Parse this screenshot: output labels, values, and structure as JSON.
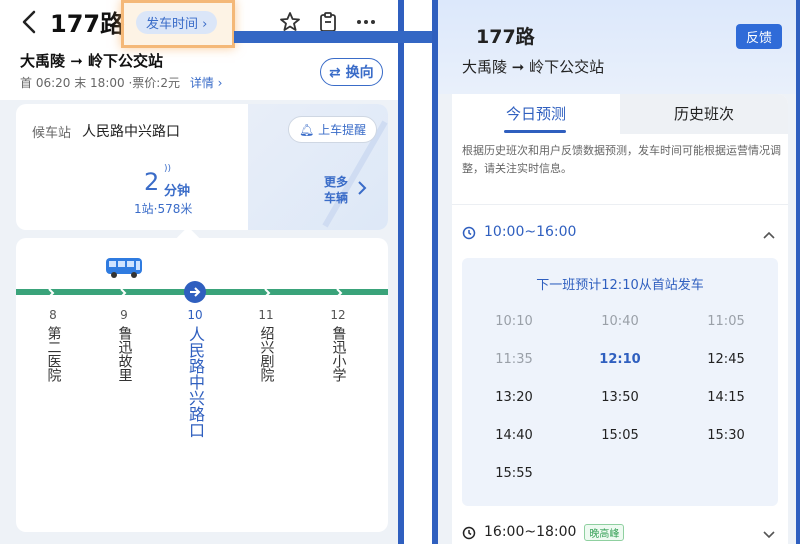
{
  "left": {
    "route_title": "177路",
    "depart_time_label": "发车时间",
    "route_from": "大禹陵",
    "route_to": "岭下公交站",
    "first_bus": "首 06:20",
    "last_bus": "末 18:00",
    "fare": "票价:2元",
    "detail_label": "详情",
    "swap_label": "换向",
    "wait_label": "候车站",
    "wait_stop": "人民路中兴路口",
    "remind_label": "上车提醒",
    "eta_minutes": "2",
    "eta_unit": "分钟",
    "eta_distance": "1站·578米",
    "more_buses_line1": "更多",
    "more_buses_line2": "车辆",
    "stops": [
      {
        "num": "8",
        "name": "第二医院",
        "active": false
      },
      {
        "num": "9",
        "name": "鲁迅故里",
        "active": false
      },
      {
        "num": "10",
        "name": "人民路中兴路口",
        "active": true
      },
      {
        "num": "11",
        "name": "绍兴剧院",
        "active": false
      },
      {
        "num": "12",
        "name": "鲁迅小学",
        "active": false
      }
    ]
  },
  "right": {
    "title": "177路",
    "route_from": "大禹陵",
    "route_to": "岭下公交站",
    "feedback_label": "反馈",
    "tabs": [
      {
        "label": "今日预测",
        "active": true
      },
      {
        "label": "历史班次",
        "active": false
      }
    ],
    "note": "根据历史班次和用户反馈数据预测，发车时间可能根据运营情况调整，请关注实时信息。",
    "periods": [
      {
        "label": "10:00~16:00",
        "badge": "",
        "expanded": true
      },
      {
        "label": "16:00~18:00",
        "badge": "晚高峰",
        "expanded": false
      }
    ],
    "next_departure": "下一班预计12:10从首站发车",
    "times": [
      {
        "t": "10:10",
        "state": "past"
      },
      {
        "t": "10:40",
        "state": "past"
      },
      {
        "t": "11:05",
        "state": "past"
      },
      {
        "t": "11:35",
        "state": "past"
      },
      {
        "t": "12:10",
        "state": "next"
      },
      {
        "t": "12:45",
        "state": "future"
      },
      {
        "t": "13:20",
        "state": "future"
      },
      {
        "t": "13:50",
        "state": "future"
      },
      {
        "t": "14:15",
        "state": "future"
      },
      {
        "t": "14:40",
        "state": "future"
      },
      {
        "t": "15:05",
        "state": "future"
      },
      {
        "t": "15:30",
        "state": "future"
      },
      {
        "t": "15:55",
        "state": "future"
      }
    ]
  },
  "colors": {
    "accent_blue": "#2f5fbf",
    "link_blue": "#3a6cc8",
    "track_green": "#3aa37a",
    "highlight_orange": "#f4b878",
    "badge_green": "#3aa35a"
  },
  "icons": [
    "back-chevron-icon",
    "star-icon",
    "clipboard-icon",
    "more-dots-icon",
    "swap-arrows-icon",
    "bell-icon",
    "signal-icon",
    "chevron-right-icon",
    "bus-icon",
    "arrow-right-circle-icon",
    "clock-icon",
    "chevron-up-icon",
    "chevron-down-icon"
  ]
}
